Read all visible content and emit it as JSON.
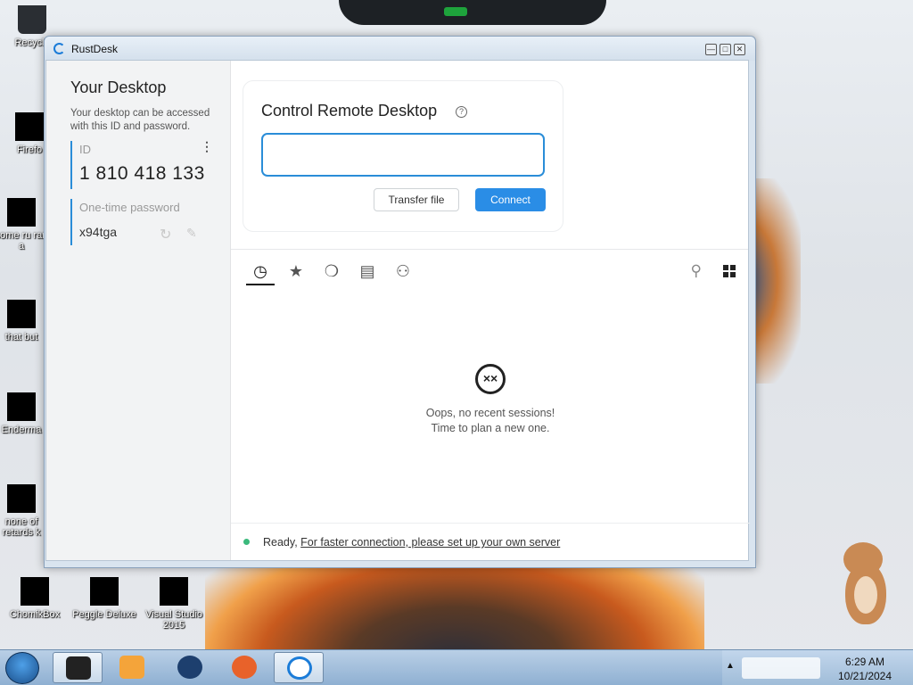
{
  "window": {
    "title": "RustDesk"
  },
  "left_pane": {
    "title": "Your Desktop",
    "description": "Your desktop can be accessed with this ID and password.",
    "id_label": "ID",
    "id_value": "1 810 418 133",
    "password_label": "One-time password",
    "password_value": "x94tga"
  },
  "connect_card": {
    "title": "Control Remote Desktop",
    "remote_id_value": "",
    "transfer_label": "Transfer file",
    "connect_label": "Connect"
  },
  "tabs": [
    {
      "icon": "clock-icon",
      "label": "Recent sessions",
      "active": true
    },
    {
      "icon": "star-icon",
      "label": "Favorites",
      "active": false
    },
    {
      "icon": "compass-icon",
      "label": "Discovered",
      "active": false
    },
    {
      "icon": "address-book-icon",
      "label": "Address book",
      "active": false
    },
    {
      "icon": "group-icon",
      "label": "Group",
      "active": false
    }
  ],
  "empty_state": {
    "line1": "Oops, no recent sessions!",
    "line2": "Time to plan a new one."
  },
  "status": {
    "text": "Ready, ",
    "link": "For faster connection, please set up your own server",
    "color": "#3bb97c"
  },
  "desktop_icons": [
    {
      "label": "Recycle"
    },
    {
      "label": "Firefo"
    },
    {
      "label": "some ru ran a"
    },
    {
      "label": "that but"
    },
    {
      "label": "Enderma"
    },
    {
      "label": "none of retards k"
    },
    {
      "label": "ChomikBox"
    },
    {
      "label": "Peggle Deluxe"
    },
    {
      "label": "Visual Studio 2015"
    }
  ],
  "clock": {
    "time": "6:29 AM",
    "date": "10/21/2024"
  },
  "colors": {
    "accent": "#2a8de6",
    "focus_border": "#2a8dd8"
  }
}
